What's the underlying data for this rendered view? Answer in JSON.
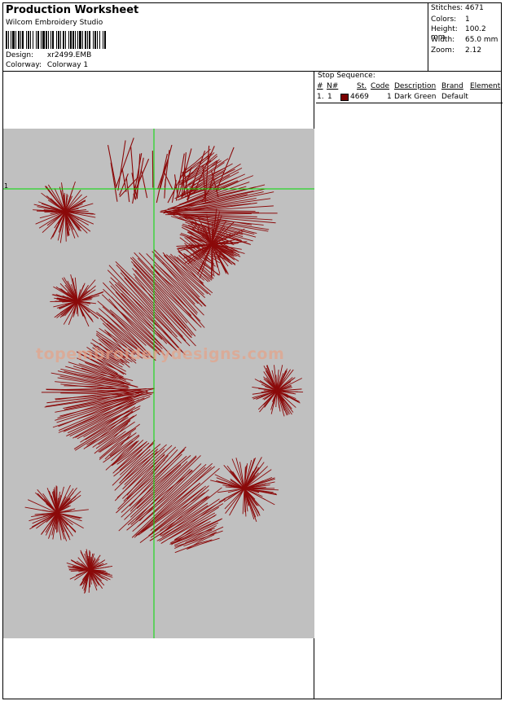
{
  "header": {
    "title": "Production Worksheet",
    "subtitle": "Wilcom Embroidery Studio",
    "design_label": "Design:",
    "design_value": "xr2499.EMB",
    "colorway_label": "Colorway:",
    "colorway_value": "Colorway 1"
  },
  "stats": {
    "stitches_label": "Stitches:",
    "stitches_value": "4671",
    "colors_label": "Colors:",
    "colors_value": "1",
    "height_label": "Height:",
    "height_value": "100.2 mm",
    "width_label": "Width:",
    "width_value": "65.0 mm",
    "zoom_label": "Zoom:",
    "zoom_value": "2.12"
  },
  "stop_sequence": {
    "title": "Stop Sequence:",
    "columns": [
      "#",
      "N#",
      "St.",
      "Code",
      "Description",
      "Brand",
      "Element"
    ],
    "rows": [
      {
        "num": "1.",
        "needle": "1",
        "stitches": "4669",
        "code": "1",
        "description": "Dark Green",
        "brand": "Default",
        "element": "",
        "swatch_color": "#7a0000"
      }
    ]
  },
  "design": {
    "thread_color": "#8b0a0a",
    "background_color": "#c0c0c0",
    "crosshair_color": "#00dd00",
    "crosshair_label": "1",
    "watermark": "topembroiderydesigns.com"
  }
}
